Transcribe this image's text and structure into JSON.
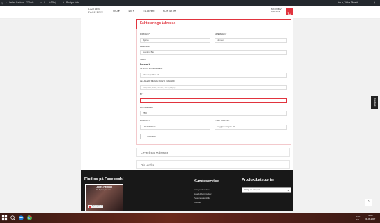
{
  "admin_bar": {
    "site_name": "Ladies Fashion",
    "updates": "7 Opda",
    "comments": "0",
    "new": "+ Tilføj",
    "edit": "Rediger side",
    "greeting": "Hej-a, Tilsfør Tilmeld"
  },
  "header": {
    "logo_line1": "LADIES",
    "logo_line2": "FASHION",
    "nav": [
      "SKO",
      "TØJ",
      "TILBEHØR",
      "KONTAKT"
    ],
    "cart_line1": "MIN KURV",
    "cart_line2": "0,00 DKK"
  },
  "billing": {
    "title": "Fakturerings Adresse",
    "firstname_label": "FORNAVN *",
    "firstname_value": "Bjørne",
    "lastname_label": "EFTERNAVN *",
    "lastname_value": "Jensen",
    "company_label": "FIRMANAVN",
    "company_value": "Evening Bar",
    "country_label": "LAND *",
    "country_value": "Danmark",
    "street_label": "VEJNAVN & HUSNUMMER *",
    "street_value": "Elmevejpakken 7",
    "apartment_label": "LEJLIGHED, SÆRLIG OG ETC. (VALGFRI)",
    "apartment_placeholder": "Lejlighed, suite, enhed, etc. (valgfri)",
    "city_label": "BY *",
    "city_value": "",
    "zip_label": "POSTNUMMER *",
    "zip_value": "7800",
    "phone_label": "TELEFON *",
    "phone_value": "+4524874032",
    "email_label": "E-MAILADRESSE *",
    "email_value": "asg@evenrgate.dk",
    "continue_button": "FORTSÆT"
  },
  "collapsed_sections": {
    "shipping": "Leverings Adresse",
    "order": "Din ordre"
  },
  "footer": {
    "facebook_heading": "Find os på Facebook!",
    "fb_page_name": "Ladies Fashion",
    "fb_page_likes": "397 Synes godt om",
    "fb_like_button": "Synes godt om",
    "service_heading": "Kundeservice",
    "service_links": [
      "Forsyndelsesinfo",
      "Handelsbetingelser",
      "Persondatapolitik",
      "Kontakt"
    ],
    "category_heading": "Produktkategorier",
    "category_select": "Vælg en kategori"
  },
  "feedback_tab": "Feedback",
  "taskbar": {
    "lang_line1": "DAN",
    "lang_line2": "DA",
    "time": "16:08",
    "date": "24-08-2017"
  },
  "colors": {
    "accent": "#e1343e",
    "admin_bar": "#23282d",
    "footer": "#181818"
  }
}
